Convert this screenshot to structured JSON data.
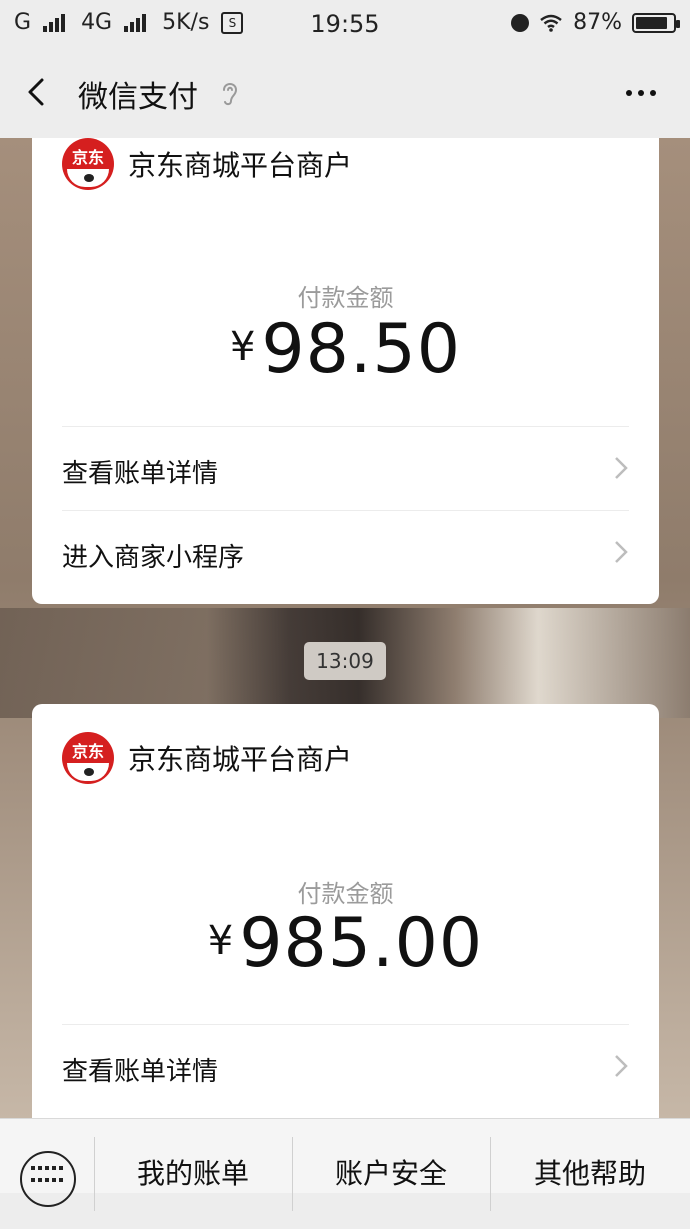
{
  "status_bar": {
    "network_left": "G",
    "network_4g": "4G",
    "speed": "5K/s",
    "s_badge": "S",
    "time": "19:55",
    "battery_percent": 87,
    "battery_text": "87%"
  },
  "nav": {
    "title": "微信支付",
    "icons": [
      "back-icon",
      "ear-icon",
      "more-icon"
    ]
  },
  "messages": [
    {
      "merchant": "京东商城平台商户",
      "logo_text": "京东",
      "amount_label": "付款金额",
      "currency": "¥",
      "amount": "98.50",
      "rows": [
        "查看账单详情",
        "进入商家小程序"
      ]
    },
    {
      "timestamp": "13:09",
      "merchant": "京东商城平台商户",
      "logo_text": "京东",
      "amount_label": "付款金额",
      "currency": "¥",
      "amount": "985.00",
      "rows": [
        "查看账单详情"
      ]
    }
  ],
  "bottom_menu": {
    "keyboard_icon": "keyboard-icon",
    "items": [
      "我的账单",
      "账户安全",
      "其他帮助"
    ]
  }
}
